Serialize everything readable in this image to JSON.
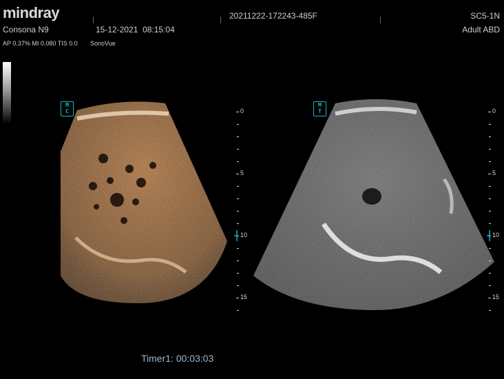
{
  "header": {
    "brand": "mindray",
    "model": "Consona N9",
    "date": "15-12-2021",
    "time": "08:15:04",
    "exam_id": "20211222-172243-485F",
    "probe": "SC5-1N",
    "preset": "Adult ABD"
  },
  "params": {
    "acoustic": "AP 0.37%  MI 0.080 TIS 0.0",
    "contrast_agent": "SonoVue"
  },
  "left_image": {
    "mode_badge_top": "M",
    "mode_badge_bottom": "C",
    "depth_labels": [
      "0",
      "5",
      "10",
      "15"
    ]
  },
  "right_image": {
    "mode_badge_top": "M",
    "mode_badge_bottom": "T",
    "depth_labels": [
      "0",
      "5",
      "10",
      "15"
    ]
  },
  "footer": {
    "timer": "Timer1: 00:03:03"
  },
  "colors": {
    "contrast_tint": "#c8864a",
    "badge_color": "#18b7c8",
    "timer_color": "#9db6cf"
  }
}
